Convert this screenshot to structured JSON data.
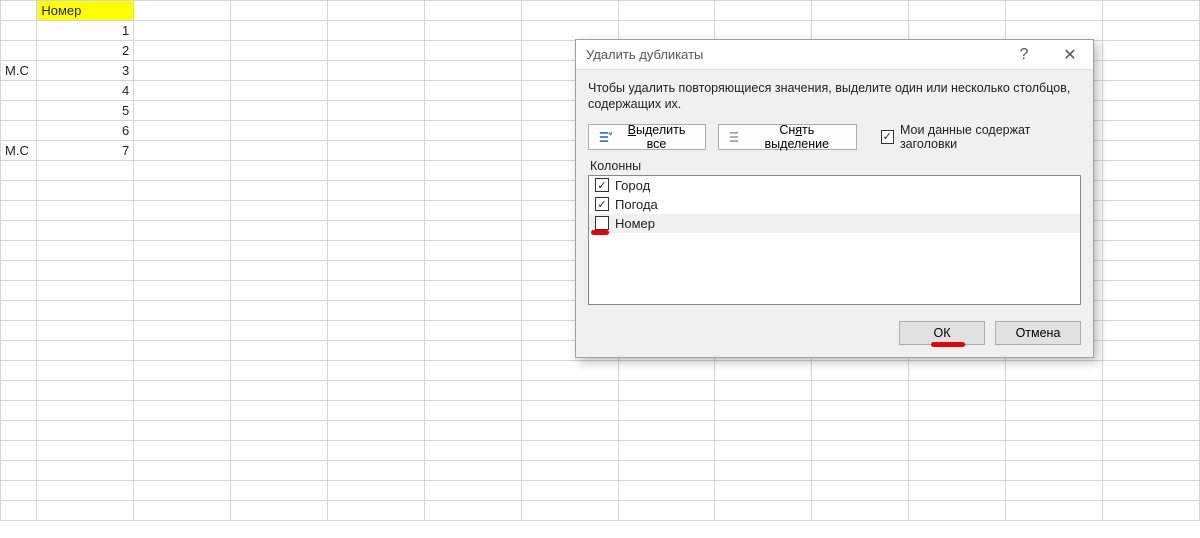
{
  "sheet": {
    "header": "Номер",
    "rows": [
      {
        "a": "",
        "b": "1"
      },
      {
        "a": "",
        "b": "2"
      },
      {
        "a": "М.С",
        "b": "3"
      },
      {
        "a": "",
        "b": "4"
      },
      {
        "a": "",
        "b": "5"
      },
      {
        "a": "",
        "b": "6"
      },
      {
        "a": "М.С",
        "b": "7"
      }
    ]
  },
  "dialog": {
    "title": "Удалить дубликаты",
    "help_icon": "?",
    "close_icon": "✕",
    "instruction": "Чтобы удалить повторяющиеся значения, выделите один или несколько столбцов, содержащих их.",
    "select_all": "Выделить все",
    "unselect_all": "Снять выделение",
    "select_all_u": "В",
    "unselect_all_u": "я",
    "headers_label": "Мои данные содержат заголовки",
    "headers_checked": true,
    "columns_label": "Колонны",
    "columns": [
      {
        "name": "Город",
        "checked": true
      },
      {
        "name": "Погода",
        "checked": true
      },
      {
        "name": "Номер",
        "checked": false
      }
    ],
    "ok": "ОК",
    "cancel": "Отмена"
  }
}
